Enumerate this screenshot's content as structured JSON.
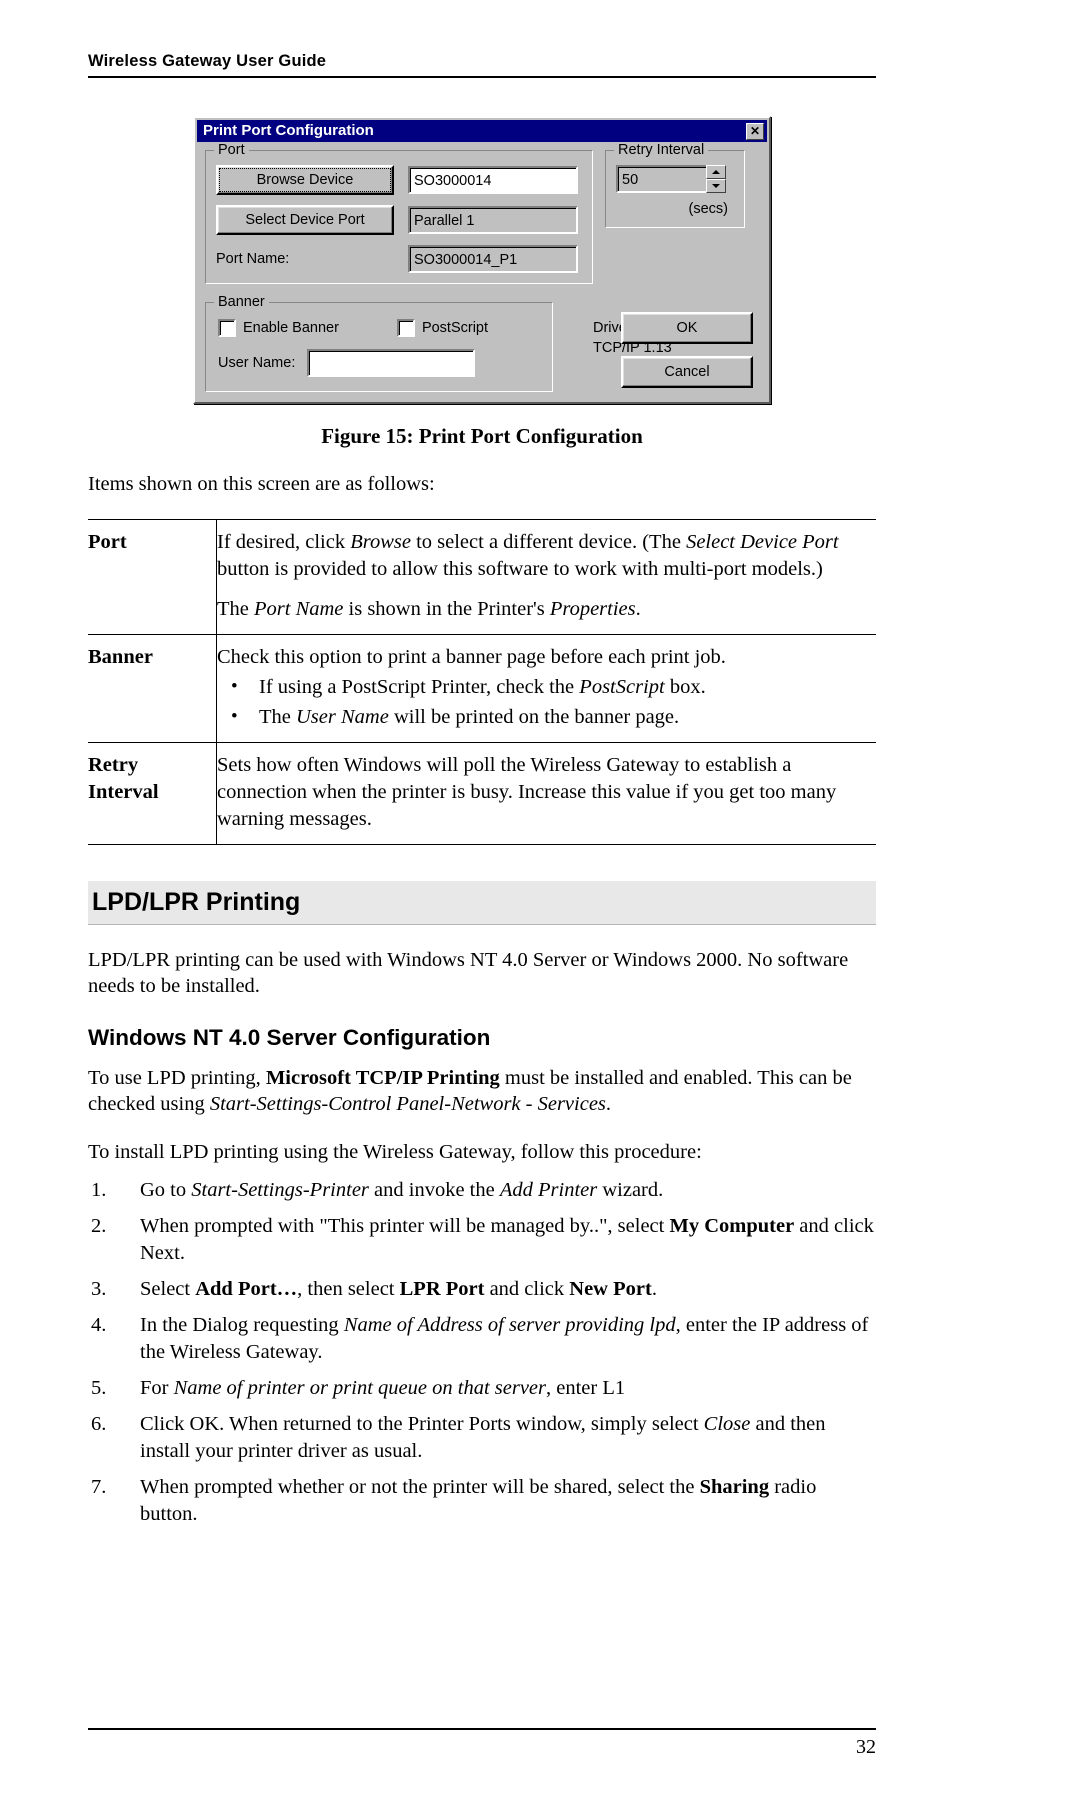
{
  "header": {
    "title": "Wireless Gateway User Guide"
  },
  "dialog": {
    "title": "Print Port Configuration",
    "close_label": "✕",
    "port_group": {
      "legend": "Port",
      "browse_button": "Browse Device",
      "device_value": "SO3000014",
      "select_device_port_button": "Select Device Port",
      "device_port_value": "Parallel 1",
      "port_name_label": "Port Name:",
      "port_name_value": "SO3000014_P1"
    },
    "retry_group": {
      "legend": "Retry Interval",
      "value": "50",
      "units": "(secs)"
    },
    "driver": {
      "label": "Driver Version:",
      "value": "TCP/IP  1.13"
    },
    "banner_group": {
      "legend": "Banner",
      "enable_banner_label": "Enable Banner",
      "enable_banner_checked": false,
      "postscript_label": "PostScript",
      "postscript_checked": false,
      "user_name_label": "User Name:",
      "user_name_value": ""
    },
    "ok_button": "OK",
    "cancel_button": "Cancel"
  },
  "figure": {
    "caption": "Figure 15: Print Port Configuration"
  },
  "intro": {
    "items_line": "Items shown on this screen are as follows:"
  },
  "defs_table": {
    "rows": [
      {
        "term": "Port",
        "paragraphs": [
          "If desired, click Browse to select a different device. (The Select Device Port button is provided to allow this software to work with multi-port models.)",
          "The Port Name is shown in the Printer's Properties."
        ]
      },
      {
        "term": "Banner",
        "paragraphs": [
          "Check this option to print a banner page before each print job."
        ],
        "bullets": [
          "If using a PostScript Printer, check the PostScript box.",
          "The User Name will be printed on the banner page."
        ]
      },
      {
        "term": "Retry Interval",
        "paragraphs": [
          "Sets how often Windows will poll the Wireless Gateway to establish a connection when the printer is busy. Increase this value if you get too many warning messages."
        ]
      }
    ]
  },
  "sections": {
    "lpd_heading": "LPD/LPR Printing",
    "lpd_intro": "LPD/LPR printing can be used with Windows NT 4.0 Server or Windows 2000. No software needs to be installed.",
    "nt_heading": "Windows NT 4.0 Server Configuration",
    "nt_para1": "To use LPD printing, Microsoft TCP/IP Printing must be installed and enabled. This can be checked using Start-Settings-Control Panel-Network - Services.",
    "nt_para2": "To install LPD printing using the Wireless Gateway, follow this procedure:",
    "steps": [
      {
        "num": "1.",
        "text": "Go to Start-Settings-Printer and invoke the Add Printer wizard."
      },
      {
        "num": "2.",
        "text": "When prompted with \"This printer will be managed by..\", select My Computer and click Next."
      },
      {
        "num": "3.",
        "text": "Select Add Port…, then select LPR Port and click New Port."
      },
      {
        "num": "4.",
        "text": "In the Dialog requesting Name of Address of server providing lpd, enter the IP address of the Wireless Gateway."
      },
      {
        "num": "5.",
        "text": "For Name of printer or print queue on that server, enter L1"
      },
      {
        "num": "6.",
        "text": "Click OK. When returned to the Printer Ports window, simply select Close and then install your printer driver as usual."
      },
      {
        "num": "7.",
        "text": "When prompted whether or not the printer will be shared, select the Sharing radio button."
      }
    ]
  },
  "footer": {
    "page_number": "32"
  }
}
